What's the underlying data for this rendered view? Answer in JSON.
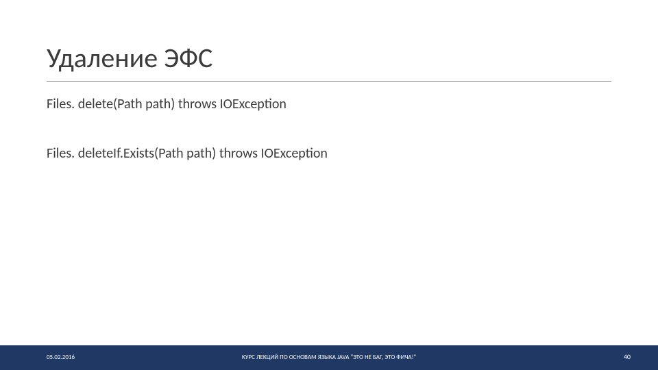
{
  "slide": {
    "title": "Удаление ЭФС",
    "line1": "Files. delete(Path path) throws IOException",
    "line2": "Files. deleteIf.Exists(Path path) throws IOException"
  },
  "footer": {
    "date": "05.02.2016",
    "center": "КУРС ЛЕКЦИЙ ПО ОСНОВАМ ЯЗЫКА JAVA \"ЭТО НЕ БАГ, ЭТО ФИЧА!\"",
    "page": "40"
  }
}
